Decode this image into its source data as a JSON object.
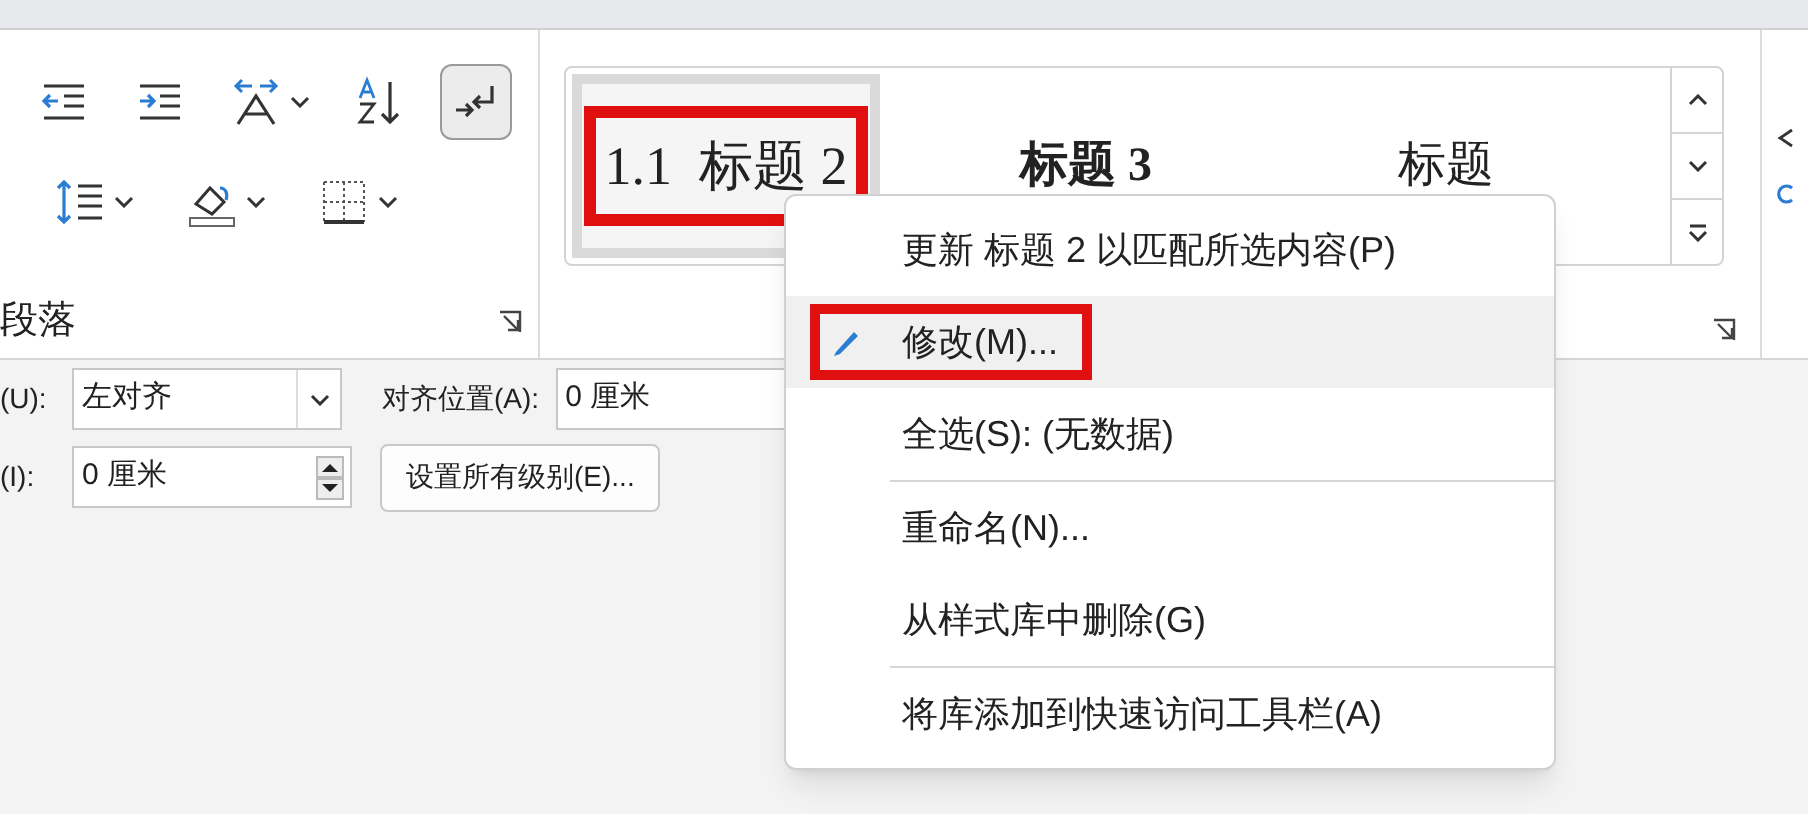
{
  "ribbon": {
    "paragraph_group": {
      "label": "段落",
      "row1": [
        {
          "kind": "outdent",
          "pressed": false,
          "dropdown": false
        },
        {
          "kind": "indent",
          "pressed": false,
          "dropdown": false
        },
        {
          "kind": "textdir",
          "pressed": false,
          "dropdown": true
        },
        {
          "kind": "sort",
          "pressed": false,
          "dropdown": false
        },
        {
          "kind": "marks",
          "pressed": true,
          "dropdown": false
        }
      ],
      "row2": [
        {
          "kind": "spacing",
          "pressed": false,
          "dropdown": true
        },
        {
          "kind": "shading",
          "pressed": false,
          "dropdown": true
        },
        {
          "kind": "borders",
          "pressed": false,
          "dropdown": true
        }
      ]
    },
    "styles_gallery": {
      "items": [
        {
          "label": "1.1  标题 2",
          "kind": "numbered",
          "selected": true,
          "highlighted": true
        },
        {
          "label": "标题 3",
          "kind": "bold",
          "selected": false,
          "highlighted": false
        },
        {
          "label": "标题",
          "kind": "plain",
          "selected": false,
          "highlighted": false
        }
      ]
    }
  },
  "dialog": {
    "rows": [
      {
        "label": "(U):",
        "field": {
          "kind": "combo",
          "value": "左对齐"
        },
        "extra_label": "对齐位置(A):",
        "extra_field": "0 厘米"
      },
      {
        "label": "(I):",
        "field": {
          "kind": "spin",
          "value": "0 厘米"
        },
        "button": "设置所有级别(E)..."
      }
    ]
  },
  "context_menu": {
    "items": [
      {
        "label": "更新 标题 2 以匹配所选内容(P)",
        "hovered": false,
        "highlighted": false,
        "icon": false,
        "divider_after": false
      },
      {
        "label": "修改(M)...",
        "hovered": true,
        "highlighted": true,
        "icon": true,
        "divider_after": false
      },
      {
        "label": "全选(S): (无数据)",
        "hovered": false,
        "highlighted": false,
        "icon": false,
        "divider_after": true
      },
      {
        "label": "重命名(N)...",
        "hovered": false,
        "highlighted": false,
        "icon": false,
        "divider_after": false
      },
      {
        "label": "从样式库中删除(G)",
        "hovered": false,
        "highlighted": false,
        "icon": false,
        "divider_after": true
      },
      {
        "label": "将库添加到快速访问工具栏(A)",
        "hovered": false,
        "highlighted": false,
        "icon": false,
        "divider_after": false
      }
    ]
  }
}
